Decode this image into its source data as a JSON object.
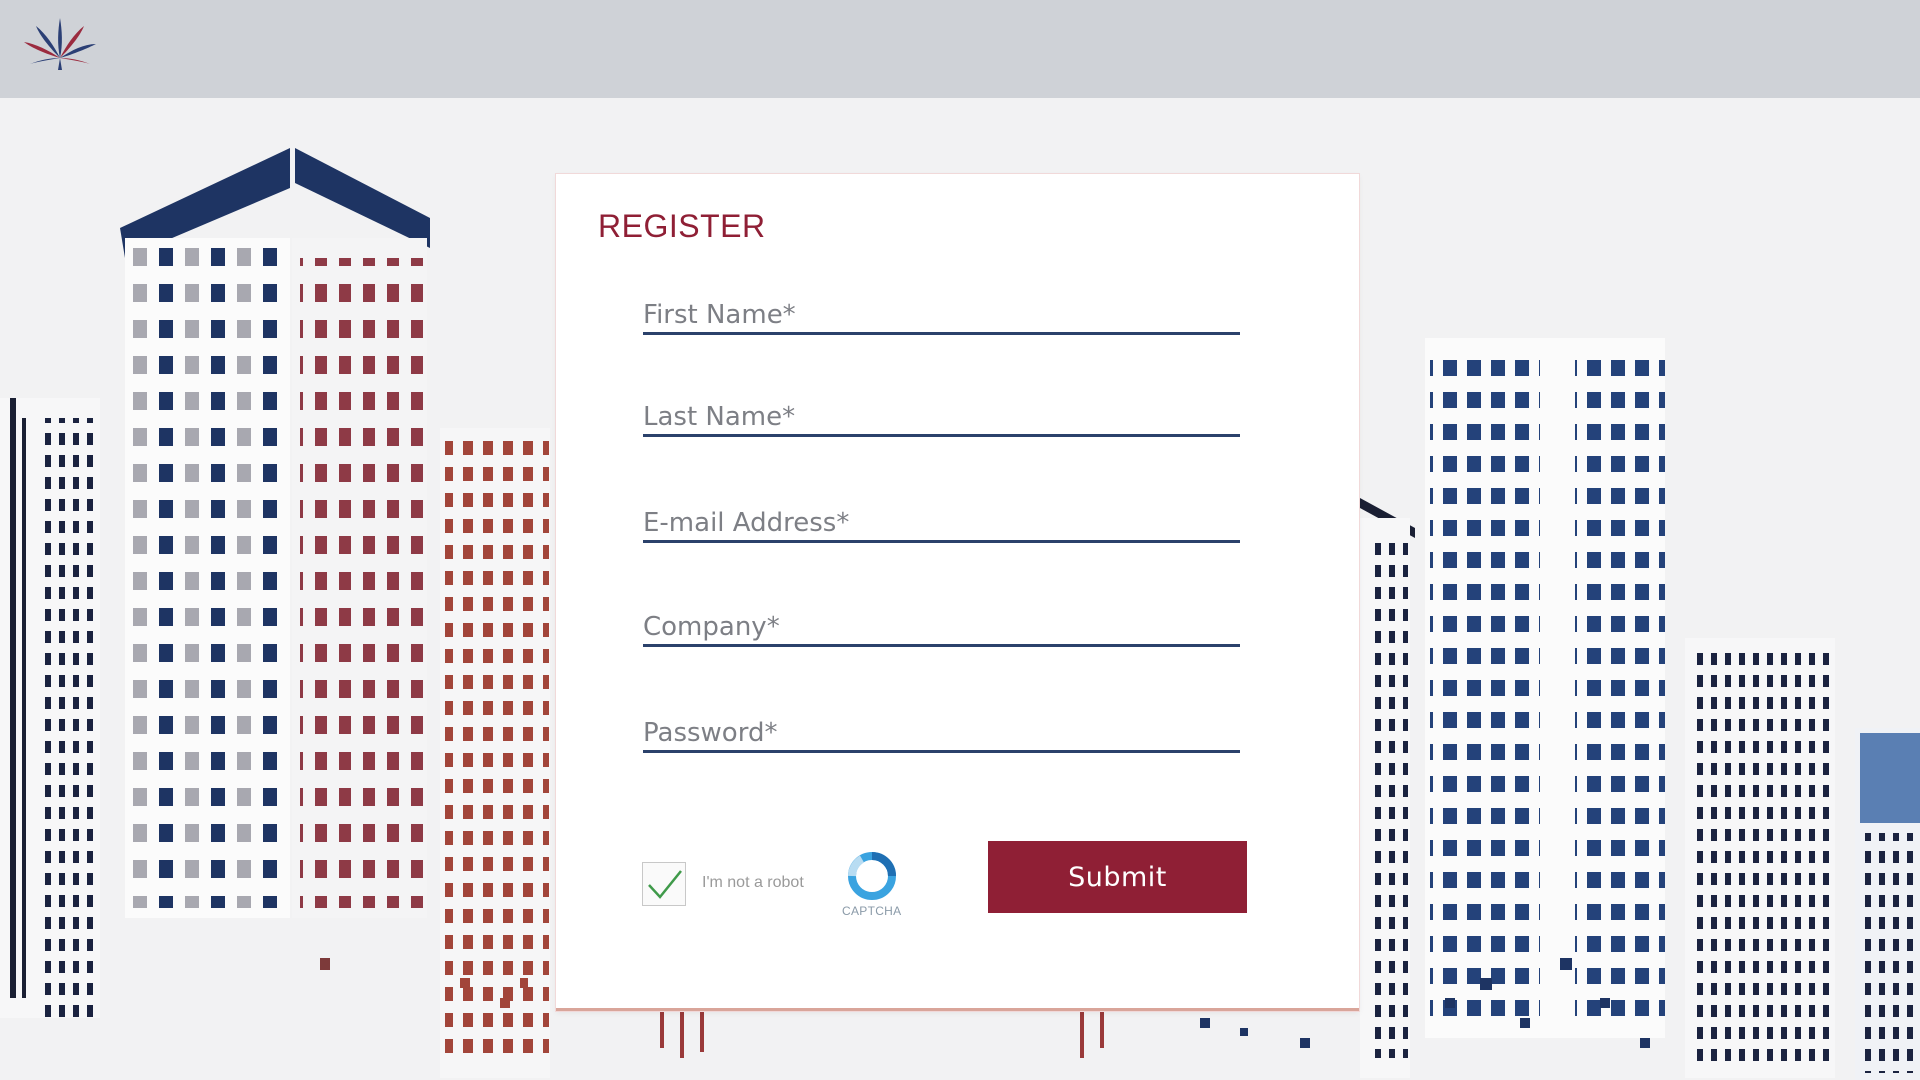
{
  "page": {
    "title": "REGISTER"
  },
  "form": {
    "first_name_placeholder": "First Name*",
    "last_name_placeholder": "Last Name*",
    "email_placeholder": "E-mail Address*",
    "company_placeholder": "Company*",
    "password_placeholder": "Password*",
    "captcha_label": "I'm not a robot",
    "captcha_brand": "CAPTCHA",
    "captcha_checked": true,
    "submit_label": "Submit"
  },
  "colors": {
    "accent": "#8f1f35",
    "field_underline": "#2b416b",
    "header_bg": "#cfd2d7",
    "page_bg": "#f2f2f3",
    "building_navy": "#1e3463",
    "building_red": "#9a3a2e"
  },
  "icons": {
    "logo": "leaf-logo-icon",
    "captcha_check": "checkmark-icon",
    "captcha_logo": "captcha-refresh-icon"
  }
}
